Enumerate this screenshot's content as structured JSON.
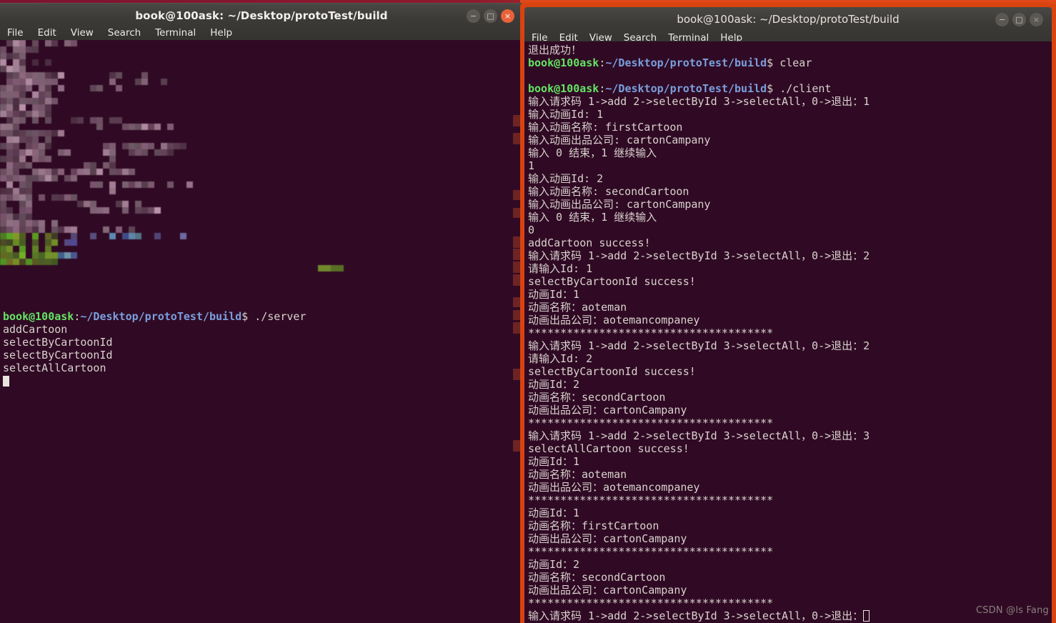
{
  "desktop": {
    "background_color": "#300a1f",
    "accent_orange": "#d8430f"
  },
  "watermark": {
    "text": "CSDN @ls Fang"
  },
  "left_window": {
    "title": "book@100ask: ~/Desktop/protoTest/build",
    "focused": true,
    "menu": [
      "File",
      "Edit",
      "View",
      "Search",
      "Terminal",
      "Help"
    ],
    "window_buttons": [
      {
        "name": "minimize",
        "glyph": "−",
        "state": "normal"
      },
      {
        "name": "maximize",
        "glyph": "□",
        "state": "normal"
      },
      {
        "name": "close",
        "glyph": "×",
        "state": "active"
      }
    ],
    "terminal": {
      "background_color": "#300a24",
      "obscured_region_note": "pixelated/mosaic blurred scrollback output",
      "lines": [
        {
          "segments": [
            {
              "text": "book@100ask",
              "class": "c-green"
            },
            {
              "text": ":",
              "class": "c-white"
            },
            {
              "text": "~/Desktop/protoTest/build",
              "class": "c-blue"
            },
            {
              "text": "$ ./server",
              "class": "c-white"
            }
          ]
        },
        {
          "segments": [
            {
              "text": "addCartoon",
              "class": "c-white"
            }
          ]
        },
        {
          "segments": [
            {
              "text": "selectByCartoonId",
              "class": "c-white"
            }
          ]
        },
        {
          "segments": [
            {
              "text": "selectByCartoonId",
              "class": "c-white"
            }
          ]
        },
        {
          "segments": [
            {
              "text": "selectAllCartoon",
              "class": "c-white"
            }
          ]
        },
        {
          "segments": [
            {
              "text": "",
              "class": "c-white",
              "cursor": "block"
            }
          ]
        }
      ]
    }
  },
  "right_window": {
    "title": "book@100ask: ~/Desktop/protoTest/build",
    "focused": false,
    "menu": [
      "File",
      "Edit",
      "View",
      "Search",
      "Terminal",
      "Help"
    ],
    "window_buttons": [
      {
        "name": "minimize",
        "glyph": "−",
        "state": "dim"
      },
      {
        "name": "maximize",
        "glyph": "□",
        "state": "dim"
      },
      {
        "name": "close",
        "glyph": "×",
        "state": "dim"
      }
    ],
    "terminal": {
      "background_color": "#300a24",
      "lines": [
        {
          "segments": [
            {
              "text": "退出成功！",
              "class": "c-white"
            }
          ]
        },
        {
          "segments": [
            {
              "text": "book@100ask",
              "class": "c-green"
            },
            {
              "text": ":",
              "class": "c-white"
            },
            {
              "text": "~/Desktop/protoTest/build",
              "class": "c-blue"
            },
            {
              "text": "$ clear",
              "class": "c-white"
            }
          ]
        },
        {
          "segments": [
            {
              "text": "",
              "class": "c-white"
            }
          ]
        },
        {
          "segments": [
            {
              "text": "book@100ask",
              "class": "c-green"
            },
            {
              "text": ":",
              "class": "c-white"
            },
            {
              "text": "~/Desktop/protoTest/build",
              "class": "c-blue"
            },
            {
              "text": "$ ./client",
              "class": "c-white"
            }
          ]
        },
        {
          "segments": [
            {
              "text": "输入请求码 1->add 2->selectById 3->selectAll，0->退出：1",
              "class": "c-white"
            }
          ]
        },
        {
          "segments": [
            {
              "text": "输入动画Id: 1",
              "class": "c-white"
            }
          ]
        },
        {
          "segments": [
            {
              "text": "输入动画名称: firstCartoon",
              "class": "c-white"
            }
          ]
        },
        {
          "segments": [
            {
              "text": "输入动画出品公司: cartonCampany",
              "class": "c-white"
            }
          ]
        },
        {
          "segments": [
            {
              "text": "输入 0 结束，1 继续输入",
              "class": "c-white"
            }
          ]
        },
        {
          "segments": [
            {
              "text": "1",
              "class": "c-white"
            }
          ]
        },
        {
          "segments": [
            {
              "text": "输入动画Id: 2",
              "class": "c-white"
            }
          ]
        },
        {
          "segments": [
            {
              "text": "输入动画名称: secondCartoon",
              "class": "c-white"
            }
          ]
        },
        {
          "segments": [
            {
              "text": "输入动画出品公司: cartonCampany",
              "class": "c-white"
            }
          ]
        },
        {
          "segments": [
            {
              "text": "输入 0 结束，1 继续输入",
              "class": "c-white"
            }
          ]
        },
        {
          "segments": [
            {
              "text": "0",
              "class": "c-white"
            }
          ]
        },
        {
          "segments": [
            {
              "text": "addCartoon success!",
              "class": "c-white"
            }
          ]
        },
        {
          "segments": [
            {
              "text": "输入请求码 1->add 2->selectById 3->selectAll，0->退出：2",
              "class": "c-white"
            }
          ]
        },
        {
          "segments": [
            {
              "text": "请输入Id: 1",
              "class": "c-white"
            }
          ]
        },
        {
          "segments": [
            {
              "text": "selectByCartoonId success!",
              "class": "c-white"
            }
          ]
        },
        {
          "segments": [
            {
              "text": "动画Id：1",
              "class": "c-white"
            }
          ]
        },
        {
          "segments": [
            {
              "text": "动画名称：aoteman",
              "class": "c-white"
            }
          ]
        },
        {
          "segments": [
            {
              "text": "动画出品公司：aotemancompaney",
              "class": "c-white"
            }
          ]
        },
        {
          "segments": [
            {
              "text": "**************************************",
              "class": "c-white"
            }
          ]
        },
        {
          "segments": [
            {
              "text": "输入请求码 1->add 2->selectById 3->selectAll，0->退出：2",
              "class": "c-white"
            }
          ]
        },
        {
          "segments": [
            {
              "text": "请输入Id: 2",
              "class": "c-white"
            }
          ]
        },
        {
          "segments": [
            {
              "text": "selectByCartoonId success!",
              "class": "c-white"
            }
          ]
        },
        {
          "segments": [
            {
              "text": "动画Id：2",
              "class": "c-white"
            }
          ]
        },
        {
          "segments": [
            {
              "text": "动画名称：secondCartoon",
              "class": "c-white"
            }
          ]
        },
        {
          "segments": [
            {
              "text": "动画出品公司：cartonCampany",
              "class": "c-white"
            }
          ]
        },
        {
          "segments": [
            {
              "text": "**************************************",
              "class": "c-white"
            }
          ]
        },
        {
          "segments": [
            {
              "text": "输入请求码 1->add 2->selectById 3->selectAll，0->退出：3",
              "class": "c-white"
            }
          ]
        },
        {
          "segments": [
            {
              "text": "selectAllCartoon success!",
              "class": "c-white"
            }
          ]
        },
        {
          "segments": [
            {
              "text": "动画Id：1",
              "class": "c-white"
            }
          ]
        },
        {
          "segments": [
            {
              "text": "动画名称：aoteman",
              "class": "c-white"
            }
          ]
        },
        {
          "segments": [
            {
              "text": "动画出品公司：aotemancompaney",
              "class": "c-white"
            }
          ]
        },
        {
          "segments": [
            {
              "text": "**************************************",
              "class": "c-white"
            }
          ]
        },
        {
          "segments": [
            {
              "text": "动画Id：1",
              "class": "c-white"
            }
          ]
        },
        {
          "segments": [
            {
              "text": "动画名称：firstCartoon",
              "class": "c-white"
            }
          ]
        },
        {
          "segments": [
            {
              "text": "动画出品公司：cartonCampany",
              "class": "c-white"
            }
          ]
        },
        {
          "segments": [
            {
              "text": "**************************************",
              "class": "c-white"
            }
          ]
        },
        {
          "segments": [
            {
              "text": "动画Id：2",
              "class": "c-white"
            }
          ]
        },
        {
          "segments": [
            {
              "text": "动画名称：secondCartoon",
              "class": "c-white"
            }
          ]
        },
        {
          "segments": [
            {
              "text": "动画出品公司：cartonCampany",
              "class": "c-white"
            }
          ]
        },
        {
          "segments": [
            {
              "text": "**************************************",
              "class": "c-white"
            }
          ]
        },
        {
          "segments": [
            {
              "text": "输入请求码 1->add 2->selectById 3->selectAll，0->退出：",
              "class": "c-white",
              "cursor": "hollow"
            }
          ]
        }
      ]
    }
  }
}
